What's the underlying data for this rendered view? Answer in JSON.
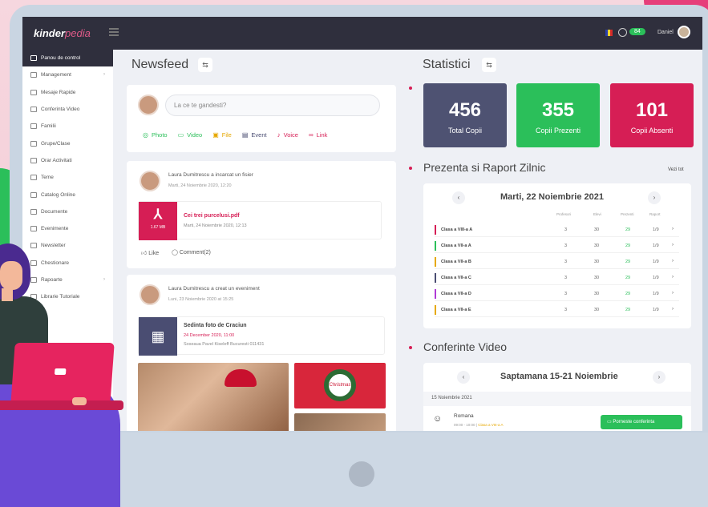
{
  "app": {
    "logo_main": "kinder",
    "logo_accent": "pedia",
    "notification_count": "84",
    "username": "Daniel"
  },
  "sidebar": {
    "items": [
      {
        "label": "Panou de control",
        "icon": "dashboard-icon",
        "active": true
      },
      {
        "label": "Management",
        "icon": "management-icon",
        "has_children": true
      },
      {
        "label": "Mesaje Rapide",
        "icon": "message-icon"
      },
      {
        "label": "Conferinta Video",
        "icon": "video-icon"
      },
      {
        "label": "Familii",
        "icon": "family-icon"
      },
      {
        "label": "Grupe/Clase",
        "icon": "group-icon"
      },
      {
        "label": "Orar Activitati",
        "icon": "calendar-icon"
      },
      {
        "label": "Teme",
        "icon": "homework-icon"
      },
      {
        "label": "Catalog Online",
        "icon": "catalog-icon"
      },
      {
        "label": "Documente",
        "icon": "document-icon"
      },
      {
        "label": "Evenimente",
        "icon": "event-icon"
      },
      {
        "label": "Newsletter",
        "icon": "newsletter-icon"
      },
      {
        "label": "Chestionare",
        "icon": "survey-icon"
      },
      {
        "label": "Rapoarte",
        "icon": "report-icon",
        "has_children": true
      },
      {
        "label": "Librarie Tutoriale",
        "icon": "library-icon"
      }
    ]
  },
  "newsfeed": {
    "title": "Newsfeed",
    "composer": {
      "placeholder": "La ce te gandesti?",
      "actions": [
        {
          "label": "Photo",
          "icon": "photo-icon",
          "color": "#2bbf5a"
        },
        {
          "label": "Video",
          "icon": "video-icon",
          "color": "#2bbf5a"
        },
        {
          "label": "File",
          "icon": "file-icon",
          "color": "#e6a800"
        },
        {
          "label": "Event",
          "icon": "event-icon",
          "color": "#4a4d72"
        },
        {
          "label": "Voice",
          "icon": "microphone-icon",
          "color": "#d61e55"
        },
        {
          "label": "Link",
          "icon": "link-icon",
          "color": "#d61e55"
        }
      ]
    },
    "post1": {
      "author": "Laura Dumitrescu a incarcat un fisier",
      "date": "Marti, 24 Noiembrie 2020, 12:20",
      "file_name": "Cei trei purcelusi.pdf",
      "file_size": "1.67 MB",
      "file_date": "Marti, 24 Noiembrie 2020, 12:13",
      "like_label": "Like",
      "comment_label": "Comment(2)"
    },
    "post2": {
      "author": "Laura Dumitrescu a creat un eveniment",
      "date": "Luni, 23 Noiembrie 2020 at 15:25",
      "event_name": "Sedinta foto de Craciun",
      "event_date": "24 December 2020, 11:00",
      "event_location": "Soseaua Pavel Kiseleff Bucuresti 011431",
      "photo_text": "Christmas"
    }
  },
  "statistics": {
    "title": "Statistici",
    "boxes": [
      {
        "value": "456",
        "label": "Total Copii",
        "color": "#4e5272"
      },
      {
        "value": "355",
        "label": "Copii Prezenti",
        "color": "#2bbf5a"
      },
      {
        "value": "101",
        "label": "Copii Absenti",
        "color": "#d61e55"
      }
    ]
  },
  "attendance": {
    "title": "Prezenta si Raport Zilnic",
    "view_all": "Vezi tot",
    "date": "Marti, 22 Noiembrie 2021",
    "headers": [
      "Profesori",
      "Elevi",
      "Prezenti",
      "Raport"
    ],
    "rows": [
      {
        "cls": "Clasa a VIII-a A",
        "prof": "3",
        "elevi": "30",
        "prezenti": "29",
        "raport": "1/9",
        "color": "#d61e55"
      },
      {
        "cls": "Clasa a VII-a A",
        "prof": "3",
        "elevi": "30",
        "prezenti": "29",
        "raport": "1/9",
        "color": "#2bbf5a"
      },
      {
        "cls": "Clasa a VII-a B",
        "prof": "3",
        "elevi": "30",
        "prezenti": "29",
        "raport": "1/9",
        "color": "#e6a800"
      },
      {
        "cls": "Clasa a VII-a C",
        "prof": "3",
        "elevi": "30",
        "prezenti": "29",
        "raport": "1/9",
        "color": "#4a4d72"
      },
      {
        "cls": "Clasa a VII-a D",
        "prof": "3",
        "elevi": "30",
        "prezenti": "29",
        "raport": "1/9",
        "color": "#b03ad6"
      },
      {
        "cls": "Clasa a VII-a E",
        "prof": "3",
        "elevi": "30",
        "prezenti": "29",
        "raport": "1/9",
        "color": "#e6a800"
      }
    ]
  },
  "video_conf": {
    "title": "Conferinte Video",
    "week": "Saptamana 15-21 Noiembrie",
    "day": "15 Noiembrie 2021",
    "entry_title": "Romana",
    "entry_time": "09:00 - 10:00",
    "entry_class": "Clasa a VIII-a A",
    "join_label": "Porneste conferinta"
  }
}
